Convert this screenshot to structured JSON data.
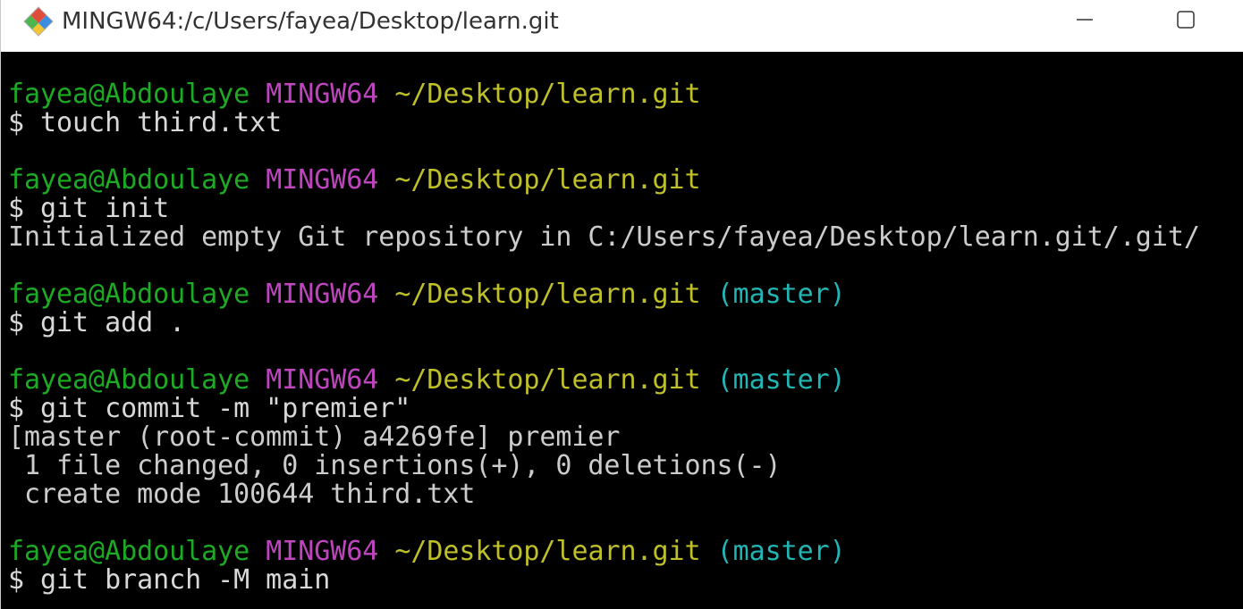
{
  "window": {
    "title": "MINGW64:/c/Users/fayea/Desktop/learn.git"
  },
  "terminal": {
    "blocks": [
      {
        "prompt": {
          "user": "fayea@Abdoulaye",
          "host": "MINGW64",
          "path": "~/Desktop/learn.git",
          "branch": ""
        },
        "command": "$ touch third.txt",
        "output": []
      },
      {
        "prompt": {
          "user": "fayea@Abdoulaye",
          "host": "MINGW64",
          "path": "~/Desktop/learn.git",
          "branch": ""
        },
        "command": "$ git init",
        "output": [
          "Initialized empty Git repository in C:/Users/fayea/Desktop/learn.git/.git/"
        ]
      },
      {
        "prompt": {
          "user": "fayea@Abdoulaye",
          "host": "MINGW64",
          "path": "~/Desktop/learn.git",
          "branch": "(master)"
        },
        "command": "$ git add .",
        "output": []
      },
      {
        "prompt": {
          "user": "fayea@Abdoulaye",
          "host": "MINGW64",
          "path": "~/Desktop/learn.git",
          "branch": "(master)"
        },
        "command": "$ git commit -m \"premier\"",
        "output": [
          "[master (root-commit) a4269fe] premier",
          " 1 file changed, 0 insertions(+), 0 deletions(-)",
          " create mode 100644 third.txt"
        ]
      },
      {
        "prompt": {
          "user": "fayea@Abdoulaye",
          "host": "MINGW64",
          "path": "~/Desktop/learn.git",
          "branch": "(master)"
        },
        "command": "$ git branch -M main",
        "output": []
      }
    ]
  },
  "colors": {
    "user": "#1cab22",
    "host": "#bf45bf",
    "path": "#bfbf2a",
    "branch": "#22b5b5",
    "background": "#000000"
  },
  "icons": {
    "app": "git-bash-diamond-icon",
    "minimize": "minimize-icon",
    "maximize": "maximize-icon"
  }
}
